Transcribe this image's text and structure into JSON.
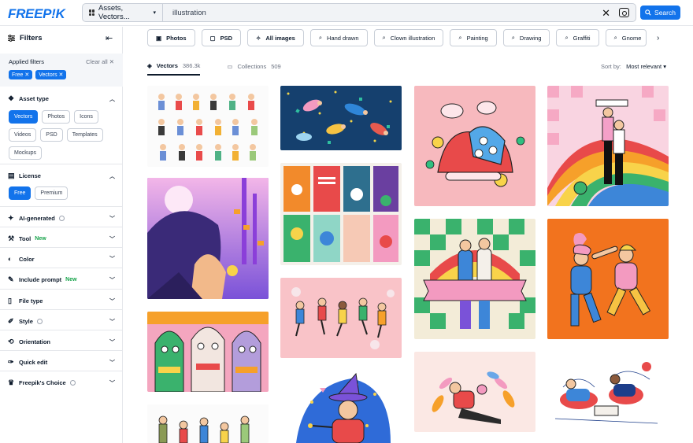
{
  "header": {
    "logo": "FREEP!K",
    "search_type": "Assets, Vectors...",
    "search_value": "illustration",
    "search_button": "Search"
  },
  "sidebar": {
    "title": "Filters",
    "applied_label": "Applied filters",
    "clear_all": "Clear all",
    "applied_chips": [
      "Free",
      "Vectors"
    ],
    "asset_type": {
      "label": "Asset type",
      "options": [
        "Vectors",
        "Photos",
        "Icons",
        "Videos",
        "PSD",
        "Templates",
        "Mockups"
      ],
      "selected": "Vectors"
    },
    "license": {
      "label": "License",
      "options": [
        "Free",
        "Premium"
      ],
      "selected": "Free"
    },
    "sections": [
      {
        "label": "AI-generated",
        "icon": "ai-icon",
        "info": true
      },
      {
        "label": "Tool",
        "icon": "tool-icon",
        "badge": "New"
      },
      {
        "label": "Color",
        "icon": "palette-icon"
      },
      {
        "label": "Include prompt",
        "icon": "prompt-icon",
        "badge": "New"
      },
      {
        "label": "File type",
        "icon": "file-icon"
      },
      {
        "label": "Style",
        "icon": "style-icon",
        "info": true
      },
      {
        "label": "Orientation",
        "icon": "orientation-icon"
      },
      {
        "label": "Quick edit",
        "icon": "edit-icon"
      },
      {
        "label": "Freepik's Choice",
        "icon": "crown-icon",
        "info": true
      }
    ]
  },
  "tags": [
    {
      "label": "Photos",
      "icon": "image-icon",
      "bold": true
    },
    {
      "label": "PSD",
      "icon": "psd-icon",
      "bold": true
    },
    {
      "label": "All images",
      "icon": "all-images-icon",
      "bold": true
    },
    {
      "label": "Hand drawn",
      "icon": "search-icon"
    },
    {
      "label": "Clown illustration",
      "icon": "search-icon"
    },
    {
      "label": "Painting",
      "icon": "search-icon"
    },
    {
      "label": "Drawing",
      "icon": "search-icon"
    },
    {
      "label": "Graffiti",
      "icon": "search-icon"
    },
    {
      "label": "Gnome",
      "icon": "search-icon"
    }
  ],
  "tabs": [
    {
      "label": "Vectors",
      "count": "386.3k",
      "active": true
    },
    {
      "label": "Collections",
      "count": "509",
      "active": false
    }
  ],
  "sort": {
    "label": "Sort by:",
    "value": "Most relevant"
  },
  "colors": {
    "brand": "#1273eb",
    "new_badge": "#16a34a"
  }
}
